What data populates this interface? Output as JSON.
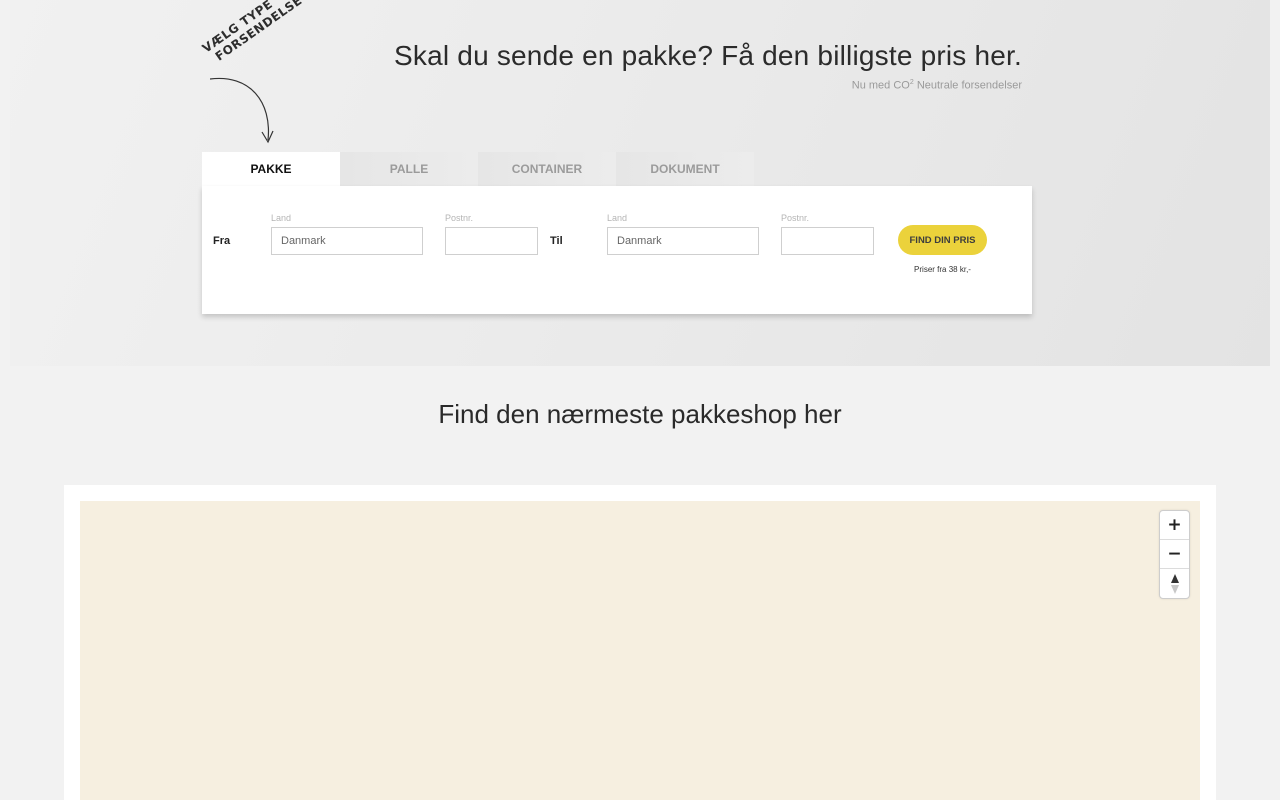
{
  "annotation": {
    "line1": "VÆLG TYPE",
    "line2": "FORSENDELSE"
  },
  "hero": {
    "title": "Skal du sende en pakke? Få den billigste pris her.",
    "subtitle_prefix": "Nu med CO",
    "subtitle_sup": "2",
    "subtitle_suffix": " Neutrale forsendelser"
  },
  "tabs": [
    {
      "label": "PAKKE",
      "active": true
    },
    {
      "label": "PALLE",
      "active": false
    },
    {
      "label": "CONTAINER",
      "active": false
    },
    {
      "label": "DOKUMENT",
      "active": false
    }
  ],
  "form": {
    "from_label": "Fra",
    "to_label": "Til",
    "from_country_label": "Land",
    "from_country_value": "Danmark",
    "from_postal_label": "Postnr.",
    "from_postal_value": "",
    "to_country_label": "Land",
    "to_country_value": "Danmark",
    "to_postal_label": "Postnr.",
    "to_postal_value": "",
    "button_label": "FIND DIN PRIS",
    "price_note": "Priser fra 38 kr,-"
  },
  "pakkeshop": {
    "title": "Find den nærmeste pakkeshop her"
  },
  "map": {
    "zoom_in": "+",
    "zoom_out": "−",
    "compass": "compass-icon"
  },
  "colors": {
    "accent_button": "#ebd23b",
    "map_background": "#f6efe0"
  }
}
